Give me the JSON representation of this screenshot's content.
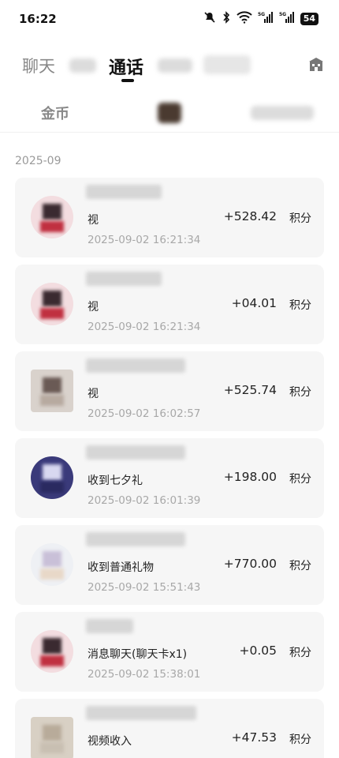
{
  "status_bar": {
    "time": "16:22",
    "battery": "54",
    "icons": [
      "mute-icon",
      "bluetooth-icon",
      "wifi-icon",
      "signal-5g-icon",
      "signal-5g-icon"
    ]
  },
  "tabs": {
    "items": [
      {
        "label": "聊天",
        "active": false
      },
      {
        "label": "通话",
        "active": true
      }
    ]
  },
  "sub_tabs": {
    "items": [
      {
        "label": "金币"
      }
    ]
  },
  "month": "2025-09",
  "unit_label": "积分",
  "records": [
    {
      "desc": "视",
      "time": "2025-09-02 16:21:34",
      "amount": "+528.42",
      "avatar": "round"
    },
    {
      "desc": "视",
      "time": "2025-09-02 16:21:34",
      "amount": "+04.01",
      "avatar": "round"
    },
    {
      "desc": "视",
      "time": "2025-09-02 16:02:57",
      "amount": "+525.74",
      "avatar": "square"
    },
    {
      "desc": "收到七夕礼",
      "time": "2025-09-02 16:01:39",
      "amount": "+198.00",
      "avatar": "round"
    },
    {
      "desc": "收到普通礼物",
      "time": "2025-09-02 15:51:43",
      "amount": "+770.00",
      "avatar": "round"
    },
    {
      "desc": "消息聊天(聊天卡x1)",
      "time": "2025-09-02 15:38:01",
      "amount": "+0.05",
      "avatar": "round"
    },
    {
      "desc": "视频收入",
      "time": "",
      "amount": "+47.53",
      "avatar": "square"
    }
  ]
}
